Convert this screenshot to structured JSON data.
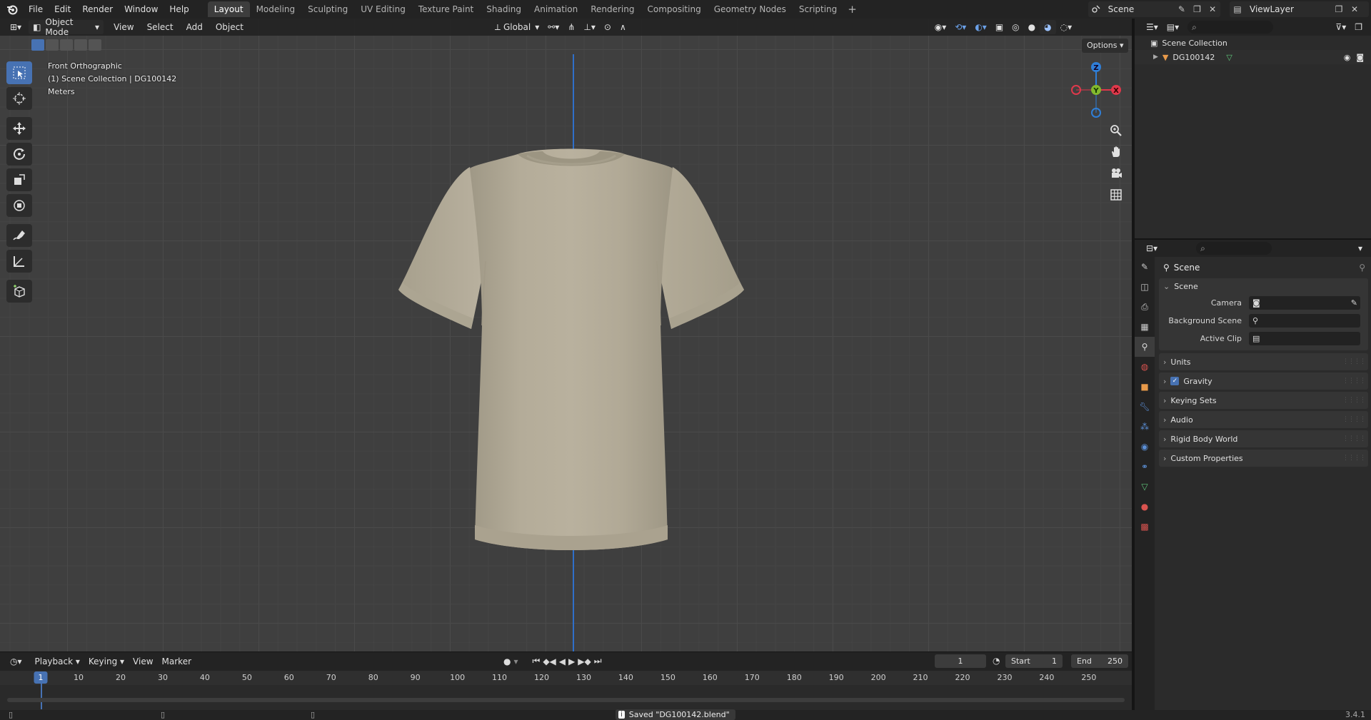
{
  "menu": [
    "File",
    "Edit",
    "Render",
    "Window",
    "Help"
  ],
  "workspaces": [
    "Layout",
    "Modeling",
    "Sculpting",
    "UV Editing",
    "Texture Paint",
    "Shading",
    "Animation",
    "Rendering",
    "Compositing",
    "Geometry Nodes",
    "Scripting"
  ],
  "active_workspace": "Layout",
  "scene_name": "Scene",
  "view_layer": "ViewLayer",
  "viewport": {
    "mode": "Object Mode",
    "menus": [
      "View",
      "Select",
      "Add",
      "Object"
    ],
    "orientation": "Global",
    "options_label": "Options",
    "info": {
      "view": "Front Orthographic",
      "collection": "(1) Scene Collection | DG100142",
      "units": "Meters"
    },
    "gizmo_axes": {
      "x": "X",
      "y": "Y",
      "z": "Z"
    }
  },
  "timeline": {
    "menus": [
      "Playback",
      "Keying",
      "View",
      "Marker"
    ],
    "current_frame": "1",
    "start_label": "Start",
    "start": "1",
    "end_label": "End",
    "end": "250",
    "ticks": [
      "1",
      "10",
      "20",
      "30",
      "40",
      "50",
      "60",
      "70",
      "80",
      "90",
      "100",
      "110",
      "120",
      "130",
      "140",
      "150",
      "160",
      "170",
      "180",
      "190",
      "200",
      "210",
      "220",
      "230",
      "240",
      "250"
    ]
  },
  "status": {
    "message": "Saved \"DG100142.blend\"",
    "version": "3.4.1"
  },
  "outliner": {
    "root": "Scene Collection",
    "object": "DG100142"
  },
  "properties": {
    "context": "Scene",
    "panel_title": "Scene",
    "fields": [
      {
        "label": "Camera"
      },
      {
        "label": "Background Scene"
      },
      {
        "label": "Active Clip"
      }
    ],
    "subpanels": [
      "Units",
      "Gravity",
      "Keying Sets",
      "Audio",
      "Rigid Body World",
      "Custom Properties"
    ]
  },
  "colors": {
    "accent": "#4772b3",
    "axis_x": "#e0384b",
    "axis_y": "#83b92d",
    "axis_z": "#2f7fd8",
    "shirt": "#b3ab98"
  }
}
